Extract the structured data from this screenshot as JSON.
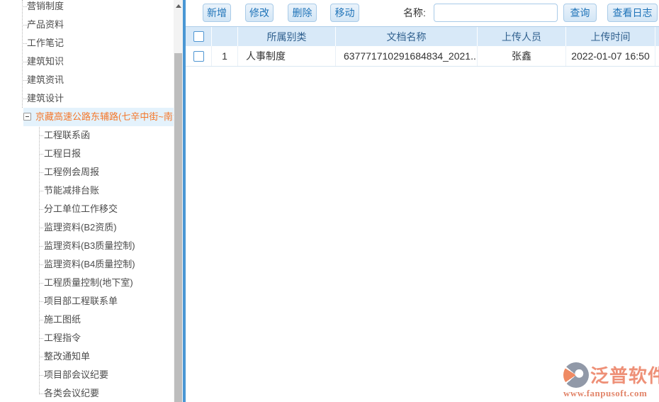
{
  "sidebar": {
    "items": [
      {
        "label": "营销制度",
        "level": 1
      },
      {
        "label": "产品资料",
        "level": 1
      },
      {
        "label": "工作笔记",
        "level": 1
      },
      {
        "label": "建筑知识",
        "level": 1
      },
      {
        "label": "建筑资讯",
        "level": 1
      },
      {
        "label": "建筑设计",
        "level": 1
      },
      {
        "label": "京藏高速公路东辅路(七辛中街~南沿)",
        "level": 1,
        "state": "expanded",
        "selected": true
      },
      {
        "label": "工程联系函",
        "level": 2
      },
      {
        "label": "工程日报",
        "level": 2
      },
      {
        "label": "工程例会周报",
        "level": 2
      },
      {
        "label": "节能减排台账",
        "level": 2
      },
      {
        "label": "分工单位工作移交",
        "level": 2
      },
      {
        "label": "监理资料(B2资质)",
        "level": 2
      },
      {
        "label": "监理资料(B3质量控制)",
        "level": 2
      },
      {
        "label": "监理资料(B4质量控制)",
        "level": 2
      },
      {
        "label": "工程质量控制(地下室)",
        "level": 2
      },
      {
        "label": "项目部工程联系单",
        "level": 2
      },
      {
        "label": "施工图纸",
        "level": 2
      },
      {
        "label": "工程指令",
        "level": 2
      },
      {
        "label": "整改通知单",
        "level": 2
      },
      {
        "label": "项目部会议纪要",
        "level": 2
      },
      {
        "label": "各类会议纪要",
        "level": 2
      }
    ]
  },
  "toolbar": {
    "add_label": "新增",
    "modify_label": "修改",
    "delete_label": "删除",
    "move_label": "移动",
    "name_label": "名称:",
    "name_value": "",
    "query_label": "查询",
    "view_log_label": "查看日志"
  },
  "table": {
    "headers": {
      "category": "所属别类",
      "doc_name": "文档名称",
      "uploader": "上传人员",
      "upload_time": "上传时间"
    },
    "rows": [
      {
        "index": "1",
        "category": "人事制度",
        "doc_name": "637771710291684834_2021...",
        "uploader": "张鑫",
        "upload_time": "2022-01-07 16:50"
      }
    ]
  },
  "watermark": {
    "brand": "泛普软件",
    "url": "www.fanpusoft.com"
  },
  "colors": {
    "accent_blue": "#1e73b8",
    "divider_blue": "#4a97d4",
    "header_bg": "#d8e9f8",
    "header_text": "#31618f",
    "selected_item_orange": "#f4772a",
    "selected_item_bg": "#e4f2fc",
    "watermark_orange": "#ee9077"
  }
}
